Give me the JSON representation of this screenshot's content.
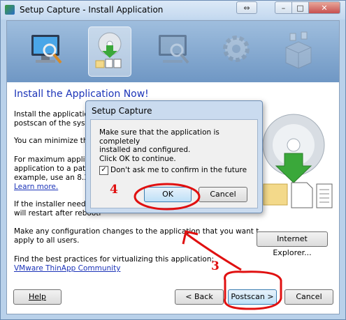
{
  "window": {
    "title": "Setup Capture - Install Application",
    "caption_buttons": {
      "resize": "⇔",
      "minimize": "–",
      "maximize": "□",
      "close": "✕"
    }
  },
  "banner": {
    "steps": [
      {
        "icon": "monitor-magnifier-icon",
        "state": "done"
      },
      {
        "icon": "disc-install-icon",
        "state": "current"
      },
      {
        "icon": "monitor-magnifier-icon",
        "state": "pending"
      },
      {
        "icon": "gear-icon",
        "state": "pending"
      },
      {
        "icon": "package-box-icon",
        "state": "pending"
      }
    ]
  },
  "main": {
    "heading": "Install the Application Now!",
    "para1_line1": "Install the application f",
    "para1_line2": "postscan of the syste",
    "para2": "You can minimize this",
    "para3_line1": "For maximum applicat",
    "para3_line2": "application to a path w",
    "para3_line3": "example, use an 8.3 D",
    "learn_more": "Learn more.",
    "para4_line1": "If the installer needs t",
    "para4_line2": "will restart after rebooti",
    "para5_line1": "Make any configuration changes to the application that you want to",
    "para5_line2": "apply to all users.",
    "para6": "Find the best practices for virtualizing this application:",
    "community_link": "VMware ThinApp Community",
    "internet_explorer_button": "Internet Explorer..."
  },
  "footer": {
    "help": "Help",
    "back": "< Back",
    "postscan": "Postscan >",
    "cancel": "Cancel"
  },
  "dialog": {
    "title": "Setup Capture",
    "message_line1": "Make sure that the application is completely",
    "message_line2": "installed and configured.",
    "message_line3": "Click OK to continue.",
    "checkbox_label": "Don't ask me to confirm in the future",
    "checkbox_checked": true,
    "checkbox_mark": "✓",
    "ok": "OK",
    "cancel": "Cancel"
  },
  "annotations": {
    "step3": "3",
    "step4": "4",
    "color": "#e01010"
  }
}
